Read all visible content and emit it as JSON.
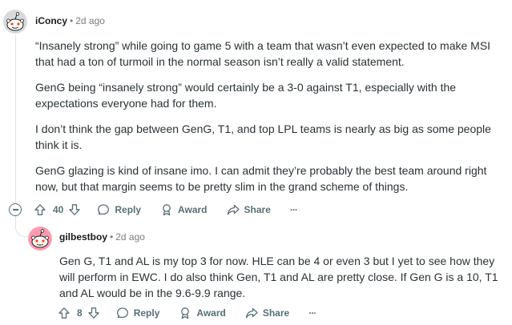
{
  "comment1": {
    "author": "iConcy",
    "separator": "•",
    "time": "2d ago",
    "paragraphs": [
      "“Insanely strong” while going to game 5 with a team that wasn’t even expected to make MSI that had a ton of turmoil in the normal season isn’t really a valid statement.",
      "GenG being “insanely strong” would certainly be a 3-0 against T1, especially with the expectations everyone had for them.",
      "I don’t think the gap between GenG, T1, and top LPL teams is nearly as big as some people think it is.",
      "GenG glazing is kind of insane imo. I can admit they’re probably the best team around right now, but that margin seems to be pretty slim in the grand scheme of things."
    ],
    "votes": "40",
    "reply_label": "Reply",
    "award_label": "Award",
    "share_label": "Share",
    "more_label": "···"
  },
  "comment2": {
    "author": "gilbestboy",
    "separator": "•",
    "time": "2d ago",
    "paragraphs": [
      "Gen G, T1 and AL is my top 3 for now. HLE can be 4 or even 3 but I yet to see how they will perform in EWC. I do also think Gen, T1 and AL are pretty close. If Gen G is a 10, T1 and AL would be in the 9.6-9.9 range."
    ],
    "votes": "8",
    "reply_label": "Reply",
    "award_label": "Award",
    "share_label": "Share",
    "more_label": "···"
  },
  "colors": {
    "avatar1_bg": "#d7dadc",
    "avatar2_bg": "#ff9ab0",
    "meta_gray": "#7c7c7c",
    "action_gray": "#576f76"
  }
}
